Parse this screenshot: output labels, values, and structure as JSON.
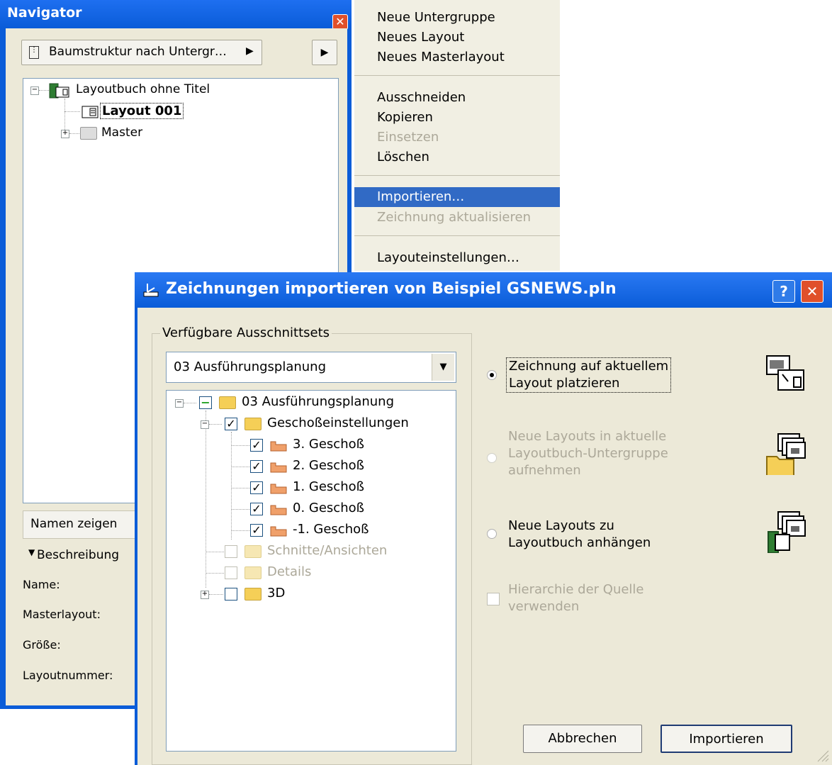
{
  "navigator": {
    "title": "Navigator",
    "close_glyph": "✕",
    "view_button_label": "Baumstruktur nach Untergr…",
    "tree": {
      "root_label": "Layoutbuch ohne Titel",
      "layout_label": "Layout 001",
      "master_label": "Master"
    },
    "names_button_label": "Namen zeigen",
    "description_label": "Beschreibung",
    "properties": {
      "name_label": "Name:",
      "master_label": "Masterlayout:",
      "size_label": "Größe:",
      "number_label": "Layoutnummer:"
    }
  },
  "context_menu": {
    "items": [
      {
        "label": "Neue Untergruppe",
        "state": "enabled"
      },
      {
        "label": "Neues Layout",
        "state": "enabled"
      },
      {
        "label": "Neues Masterlayout",
        "state": "enabled"
      },
      {
        "label": "Ausschneiden",
        "state": "enabled"
      },
      {
        "label": "Kopieren",
        "state": "enabled"
      },
      {
        "label": "Einsetzen",
        "state": "disabled"
      },
      {
        "label": "Löschen",
        "state": "enabled"
      },
      {
        "label": "Importieren…",
        "state": "selected"
      },
      {
        "label": "Zeichnung aktualisieren",
        "state": "disabled"
      },
      {
        "label": "Layouteinstellungen…",
        "state": "enabled"
      }
    ]
  },
  "dialog": {
    "title": "Zeichnungen importieren von Beispiel GSNEWS.pln",
    "help_glyph": "?",
    "close_glyph": "✕",
    "group_label": "Verfügbare Ausschnittsets",
    "selected_set": "03 Ausführungsplanung",
    "tree": {
      "root": "03 Ausführungsplanung",
      "storey_group": "Geschoßeinstellungen",
      "storeys": [
        "3. Geschoß",
        "2. Geschoß",
        "1. Geschoß",
        "0. Geschoß",
        "-1. Geschoß"
      ],
      "sections": "Schnitte/Ansichten",
      "details": "Details",
      "three_d": "3D"
    },
    "options": {
      "place_on_current_line1": "Zeichnung auf aktuellem",
      "place_on_current_line2": "Layout platzieren",
      "new_in_subset_line1": "Neue Layouts in aktuelle",
      "new_in_subset_line2": "Layoutbuch-Untergruppe",
      "new_in_subset_line3": "aufnehmen",
      "append_line1": "Neue Layouts zu",
      "append_line2": "Layoutbuch anhängen",
      "hierarchy_line1": "Hierarchie der Quelle",
      "hierarchy_line2": "verwenden"
    },
    "cancel_label": "Abbrechen",
    "import_label": "Importieren"
  },
  "colors": {
    "xp_title_blue": "#0a5cd8",
    "menu_highlight": "#316ac5",
    "dialog_face": "#ece9d8"
  }
}
